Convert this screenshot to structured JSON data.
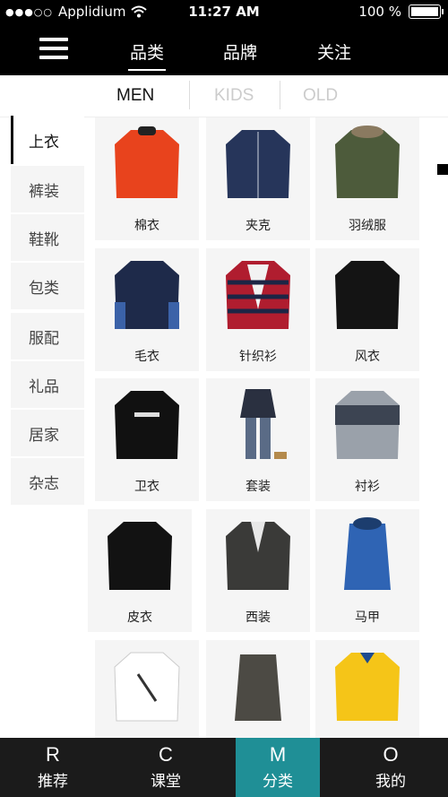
{
  "status_bar": {
    "carrier": "Applidium",
    "time": "11:27 AM",
    "battery": "100 %"
  },
  "nav": {
    "tabs": [
      {
        "label": "品类"
      },
      {
        "label": "品牌"
      },
      {
        "label": "关注"
      }
    ]
  },
  "subnav": {
    "tabs": [
      {
        "label": "MEN"
      },
      {
        "label": "KIDS"
      },
      {
        "label": "OLD"
      }
    ]
  },
  "sidebar": {
    "items": [
      {
        "label": "上衣"
      },
      {
        "label": "裤装"
      },
      {
        "label": "鞋靴"
      },
      {
        "label": "包类"
      },
      {
        "label": "服配"
      },
      {
        "label": "礼品"
      },
      {
        "label": "居家"
      },
      {
        "label": "杂志"
      }
    ]
  },
  "products": [
    {
      "label": "棉衣",
      "color": "#e8431d"
    },
    {
      "label": "夹克",
      "color": "#26355a"
    },
    {
      "label": "羽绒服",
      "color": "#4d5b3b"
    },
    {
      "label": "毛衣",
      "color": "#1e2a4a"
    },
    {
      "label": "针织衫",
      "color": "#b01d2f"
    },
    {
      "label": "风衣",
      "color": "#141414"
    },
    {
      "label": "卫衣",
      "color": "#111111"
    },
    {
      "label": "套装",
      "color": "#2a3040"
    },
    {
      "label": "衬衫",
      "color": "#9aa1aa"
    },
    {
      "label": "皮衣",
      "color": "#121212"
    },
    {
      "label": "西装",
      "color": "#3a3a38"
    },
    {
      "label": "马甲",
      "color": "#2f64b4"
    },
    {
      "label": "",
      "color": "#ffffff"
    },
    {
      "label": "",
      "color": "#4c4a44"
    },
    {
      "label": "",
      "color": "#f5c518"
    }
  ],
  "bottom_tabs": [
    {
      "icon": "R",
      "label": "推荐"
    },
    {
      "icon": "C",
      "label": "课堂"
    },
    {
      "icon": "M",
      "label": "分类"
    },
    {
      "icon": "O",
      "label": "我的"
    }
  ],
  "colors": {
    "accent": "#1f8f96",
    "bar": "#000000"
  }
}
